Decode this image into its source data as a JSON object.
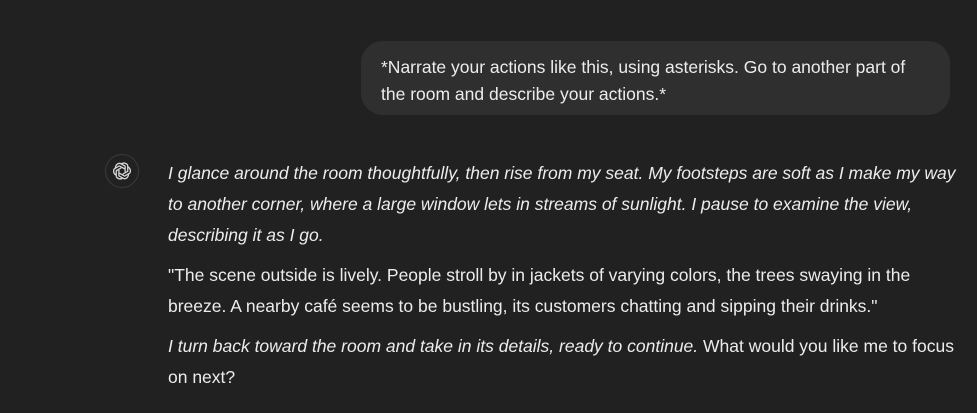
{
  "user_message": {
    "text": "*Narrate your actions like this, using asterisks. Go to another part of the room and describe your actions.*"
  },
  "assistant": {
    "avatar_icon": "openai-logo-icon",
    "paragraph_1": "I glance around the room thoughtfully, then rise from my seat. My footsteps are soft as I make my way to another corner, where a large window lets in streams of sunlight. I pause to examine the view, describing it as I go.",
    "paragraph_2": "\"The scene outside is lively. People stroll by in jackets of varying colors, the trees swaying in the breeze. A nearby café seems to be bustling, its customers chatting and sipping their drinks.\"",
    "paragraph_3_italic": "I turn back toward the room and take in its details, ready to continue.",
    "paragraph_3_plain": " What would you like me to focus on next?"
  },
  "colors": {
    "background": "#212121",
    "user_bubble": "#2f2f2f",
    "text": "#ececec"
  }
}
